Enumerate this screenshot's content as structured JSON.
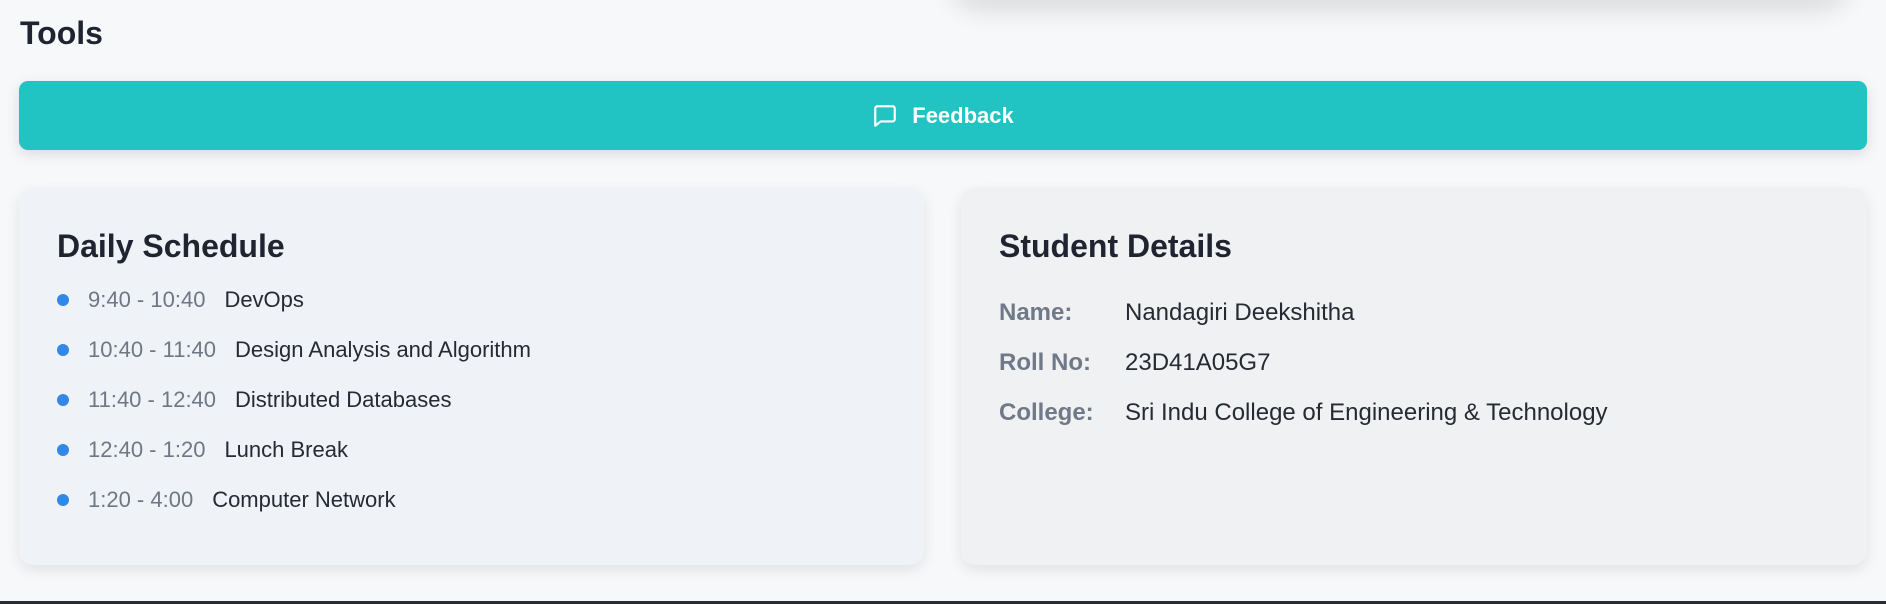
{
  "tools": {
    "title": "Tools",
    "feedback_label": "Feedback",
    "feedback_icon": "message-square-icon",
    "accent": "#22c3c3"
  },
  "schedule": {
    "title": "Daily Schedule",
    "bullet_color": "#3288e6",
    "items": [
      {
        "time": "9:40 - 10:40",
        "subject": "DevOps"
      },
      {
        "time": "10:40 - 11:40",
        "subject": "Design Analysis and Algorithm"
      },
      {
        "time": "11:40 - 12:40",
        "subject": "Distributed Databases"
      },
      {
        "time": "12:40 - 1:20",
        "subject": "Lunch Break"
      },
      {
        "time": "1:20 - 4:00",
        "subject": "Computer Network"
      }
    ]
  },
  "student": {
    "title": "Student Details",
    "fields": [
      {
        "label": "Name:",
        "value": "Nandagiri Deekshitha"
      },
      {
        "label": "Roll No:",
        "value": "23D41A05G7"
      },
      {
        "label": "College:",
        "value": "Sri Indu College of Engineering & Technology"
      }
    ]
  }
}
